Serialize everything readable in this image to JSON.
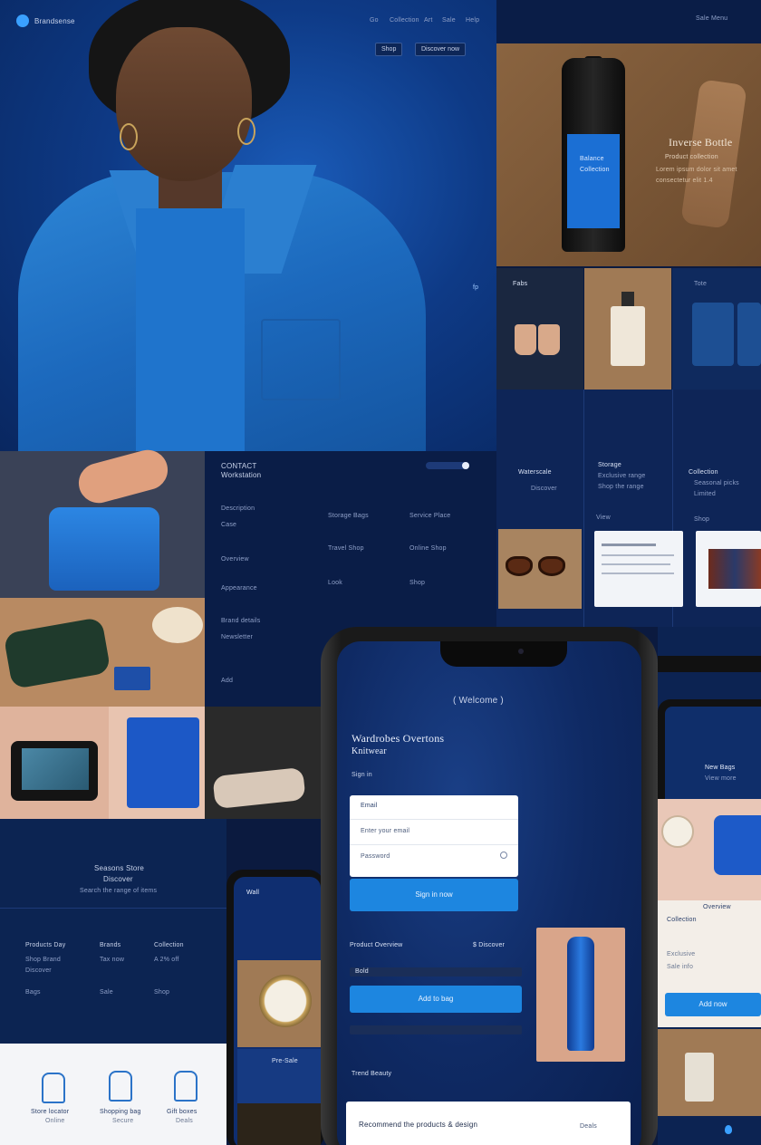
{
  "hero": {
    "brand": "Brandsense",
    "nav": [
      "Go",
      "Collection",
      "Art",
      "Sale",
      "Help"
    ],
    "nav_buttons": [
      "Shop",
      "Discover now"
    ],
    "side_badge": "fp"
  },
  "top_right": {
    "nav": "Sale Menu",
    "banner_heading": "Inverse Bottle",
    "banner_sub": "Product collection",
    "banner_lines": [
      "Lorem ipsum dolor sit amet",
      "consectetur elit 1.4"
    ],
    "bottle_label": [
      "Balance",
      "Collection"
    ]
  },
  "thumbs": {
    "t1_label": "Fabs",
    "t3_label": "Tote"
  },
  "right_mid": {
    "col1_title": "Waterscale",
    "col1_sub": "Discover",
    "col2_title": "Storage",
    "col2_lines": [
      "Exclusive range",
      "Shop the range"
    ],
    "col3_title": "Collection",
    "col3_lines": [
      "Seasonal picks",
      "Limited"
    ],
    "link1": "View",
    "link2": "Shop"
  },
  "mid_panel": {
    "title_line1": "CONTACT",
    "title_line2": "Workstation",
    "toggle": "on",
    "rows": [
      "Description",
      "Case",
      "Overview",
      "Appearance",
      "Brand details",
      "Newsletter",
      "Add"
    ],
    "grid": [
      "Storage Bags",
      "Service Place",
      "Travel Shop",
      "Online Shop"
    ],
    "footer_a": "Look",
    "footer_b": "Shop"
  },
  "low_left": {
    "title": "Seasons Store",
    "subtitle": "Discover",
    "small": "Search the range of items",
    "cols": [
      {
        "title": "Products Day",
        "lines": [
          "Shop Brand",
          "Discover",
          "Bags"
        ]
      },
      {
        "title": "Brands",
        "lines": [
          "Tax now",
          "Sale"
        ]
      },
      {
        "title": "Collection",
        "lines": [
          "A 2% off",
          "Shop"
        ]
      }
    ],
    "icons": [
      {
        "label": "Store locator",
        "sub": "Online"
      },
      {
        "label": "Shopping bag",
        "sub": "Secure"
      },
      {
        "label": "Gift boxes",
        "sub": "Deals"
      }
    ]
  },
  "small_phone": {
    "header": "Wall",
    "watch_caption": "Pre-Sale"
  },
  "big_phone": {
    "welcome": "( Welcome )",
    "heading_line1": "Wardrobes Overtons",
    "heading_line2": "Knitwear",
    "subtext": "Sign in",
    "card_label": "Email",
    "field_1_placeholder": "Enter your email",
    "field_2_placeholder": "Password",
    "submit_label": "Sign in now",
    "product_label": "Product Overview",
    "product_price": "$ Discover",
    "product_sub": "Bold",
    "add_label": "Add to bag",
    "footer_label": "Trend Beauty",
    "bottom_card": "Recommend the products & design",
    "bottom_card_tag": "Deals"
  },
  "right_low": {
    "phone_title": "New Bags",
    "phone_sub": "View more",
    "card_title": "Overview",
    "card_sub": "Collection",
    "card_lines": [
      "Exclusive",
      "Sale info"
    ],
    "card_button": "Add now"
  }
}
